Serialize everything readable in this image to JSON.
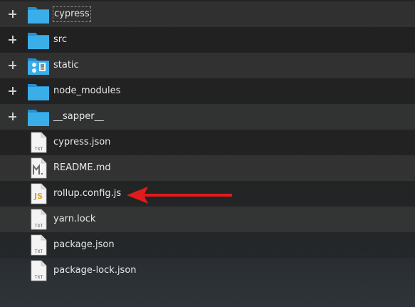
{
  "items": [
    {
      "label": "cypress",
      "type": "folder",
      "expandable": true,
      "icon": "folder-icon",
      "focused": true
    },
    {
      "label": "src",
      "type": "folder",
      "expandable": true,
      "icon": "folder-icon"
    },
    {
      "label": "static",
      "type": "folder",
      "expandable": true,
      "icon": "image-folder-icon"
    },
    {
      "label": "node_modules",
      "type": "folder",
      "expandable": true,
      "icon": "folder-icon"
    },
    {
      "label": "__sapper__",
      "type": "folder",
      "expandable": true,
      "icon": "folder-icon"
    },
    {
      "label": "cypress.json",
      "type": "file",
      "icon": "text-file-icon",
      "badge": "TXT"
    },
    {
      "label": "README.md",
      "type": "file",
      "icon": "markdown-file-icon",
      "badge": "M↓"
    },
    {
      "label": "rollup.config.js",
      "type": "file",
      "icon": "javascript-file-icon",
      "badge": "JS"
    },
    {
      "label": "yarn.lock",
      "type": "file",
      "icon": "text-file-icon",
      "badge": "TXT"
    },
    {
      "label": "package.json",
      "type": "file",
      "icon": "text-file-icon",
      "badge": "TXT"
    },
    {
      "label": "package-lock.json",
      "type": "file",
      "icon": "text-file-icon",
      "badge": "TXT"
    }
  ],
  "annotation": {
    "icon": "red-arrow-icon",
    "color": "#e01b1b",
    "points_to": "rollup.config.js"
  },
  "colors": {
    "folder": "#3aaee8",
    "folder_dark": "#2590cf",
    "file_bg": "#f4f4f4",
    "js": "#e6a21a"
  }
}
